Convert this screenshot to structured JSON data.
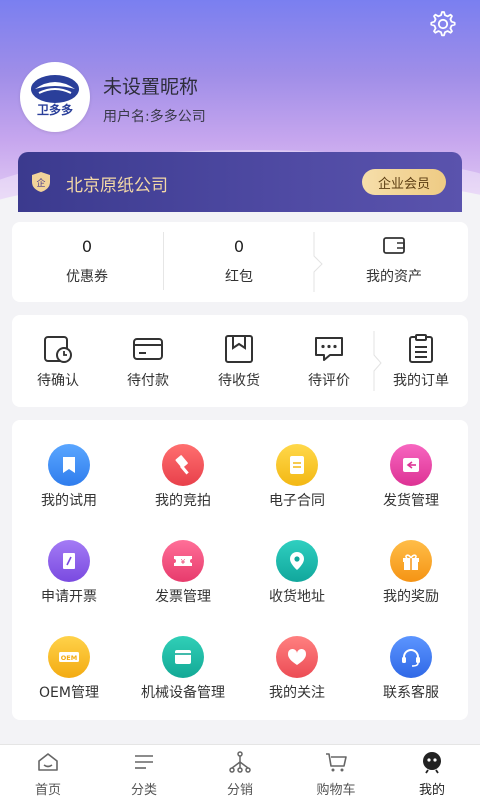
{
  "profile": {
    "nickname": "未设置昵称",
    "username": "用户名:多多公司",
    "logo_text": "卫多多"
  },
  "company": {
    "badge": "企",
    "name": "北京原纸公司",
    "member_label": "企业会员"
  },
  "assets": {
    "coupons": {
      "count": "0",
      "label": "优惠券"
    },
    "red_packets": {
      "count": "0",
      "label": "红包"
    },
    "my_assets": {
      "label": "我的资产"
    }
  },
  "orders": [
    {
      "label": "待确认",
      "icon": "clock-doc-icon"
    },
    {
      "label": "待付款",
      "icon": "card-icon"
    },
    {
      "label": "待收货",
      "icon": "bookmark-box-icon"
    },
    {
      "label": "待评价",
      "icon": "chat-dots-icon"
    },
    {
      "label": "我的订单",
      "icon": "clipboard-icon"
    }
  ],
  "tools": [
    {
      "label": "我的试用",
      "icon": "bookmark-icon",
      "color": "#3f8ff2"
    },
    {
      "label": "我的竞拍",
      "icon": "gavel-icon",
      "color": "#f0505a"
    },
    {
      "label": "电子合同",
      "icon": "document-icon",
      "color": "#f5c21c"
    },
    {
      "label": "发货管理",
      "icon": "delivery-icon",
      "color": "#e93fa0"
    },
    {
      "label": "申请开票",
      "icon": "pen-icon",
      "color": "#8a5ae8"
    },
    {
      "label": "发票管理",
      "icon": "ticket-icon",
      "color": "#f04e7a"
    },
    {
      "label": "收货地址",
      "icon": "location-icon",
      "color": "#1ab6ad"
    },
    {
      "label": "我的奖励",
      "icon": "gift-icon",
      "color": "#f7a21b"
    },
    {
      "label": "OEM管理",
      "icon": "oem-icon",
      "color": "#f7b81c",
      "icon_text": "OEM"
    },
    {
      "label": "机械设备管理",
      "icon": "window-icon",
      "color": "#1ab8a4"
    },
    {
      "label": "我的关注",
      "icon": "heart-icon",
      "color": "#f36565"
    },
    {
      "label": "联系客服",
      "icon": "headset-icon",
      "color": "#3c7cf0"
    }
  ],
  "tabbar": [
    {
      "label": "首页",
      "icon": "home-icon"
    },
    {
      "label": "分类",
      "icon": "list-icon"
    },
    {
      "label": "分销",
      "icon": "share-icon"
    },
    {
      "label": "购物车",
      "icon": "cart-icon"
    },
    {
      "label": "我的",
      "icon": "profile-icon"
    }
  ]
}
